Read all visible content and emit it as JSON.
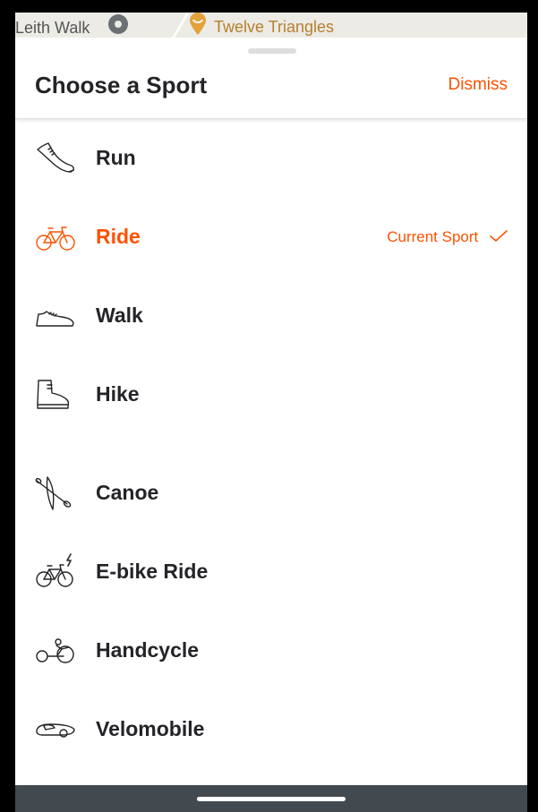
{
  "map": {
    "label_left": "Leith Walk",
    "label_right": "Twelve Triangles"
  },
  "sheet": {
    "title": "Choose a Sport",
    "dismiss_label": "Dismiss",
    "current_tag": "Current Sport"
  },
  "sports": [
    {
      "label": "Run",
      "icon": "run-shoe-icon",
      "current": false
    },
    {
      "label": "Ride",
      "icon": "bicycle-icon",
      "current": true
    },
    {
      "label": "Walk",
      "icon": "walk-shoe-icon",
      "current": false
    },
    {
      "label": "Hike",
      "icon": "hiking-boot-icon",
      "current": false
    },
    {
      "label": "Canoe",
      "icon": "canoe-icon",
      "current": false
    },
    {
      "label": "E-bike Ride",
      "icon": "ebike-icon",
      "current": false
    },
    {
      "label": "Handcycle",
      "icon": "handcycle-icon",
      "current": false
    },
    {
      "label": "Velomobile",
      "icon": "velomobile-icon",
      "current": false
    }
  ],
  "colors": {
    "accent": "#fc5200",
    "text": "#242428",
    "navbar": "#434a4f"
  }
}
